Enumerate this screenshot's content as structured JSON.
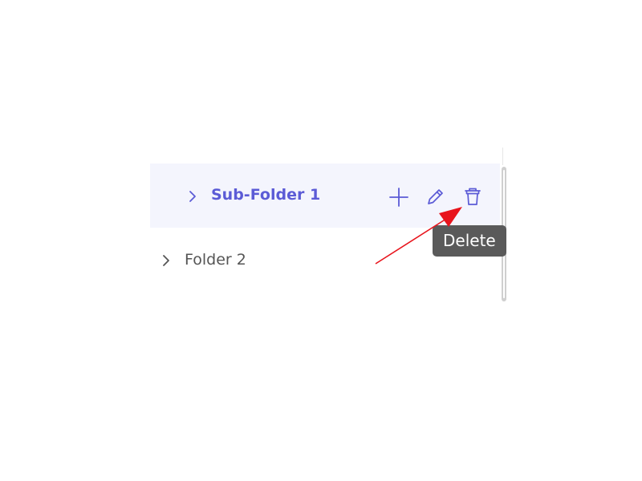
{
  "tree": {
    "items": [
      {
        "label": "Sub-Folder 1",
        "selected": true
      },
      {
        "label": "Folder 2",
        "selected": false
      }
    ],
    "actions": [
      {
        "icon": "plus-icon",
        "action": "add"
      },
      {
        "icon": "pencil-icon",
        "action": "edit"
      },
      {
        "icon": "trash-icon",
        "action": "delete"
      }
    ]
  },
  "tooltip": {
    "text": "Delete"
  },
  "colors": {
    "accent": "#5b5bd6",
    "selected_row_bg": "#f4f5fd",
    "text": "#555555",
    "tooltip_bg": "#5a5a5a",
    "annotation_arrow": "#e8141c"
  }
}
